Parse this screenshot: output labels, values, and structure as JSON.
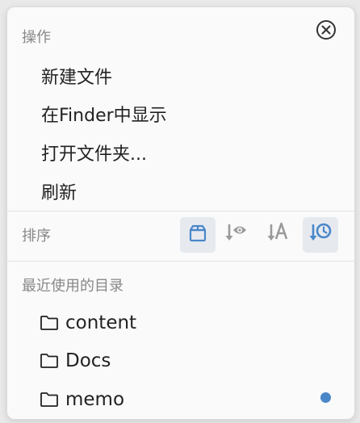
{
  "colors": {
    "accent": "#4a87c9",
    "muted_icon": "#9a9a9a",
    "text": "#222222",
    "section_title": "#888888",
    "active_bg": "#e6eaef",
    "dot": "#4a87c9"
  },
  "actions": {
    "title": "操作",
    "close_icon": "close-circle-icon",
    "items": [
      {
        "label": "新建文件"
      },
      {
        "label": "在Finder中显示"
      },
      {
        "label": "打开文件夹..."
      },
      {
        "label": "刷新"
      }
    ]
  },
  "sort": {
    "title": "排序",
    "options": [
      {
        "icon": "box-icon",
        "active": true
      },
      {
        "icon": "sort-visibility-icon",
        "active": false
      },
      {
        "icon": "sort-alpha-icon",
        "active": false
      },
      {
        "icon": "sort-time-icon",
        "active": true
      }
    ]
  },
  "recent": {
    "title": "最近使用的目录",
    "items": [
      {
        "label": "content",
        "icon": "folder-icon"
      },
      {
        "label": "Docs",
        "icon": "folder-icon"
      },
      {
        "label": "memo",
        "icon": "folder-icon",
        "indicator": "blue-dot"
      }
    ]
  }
}
